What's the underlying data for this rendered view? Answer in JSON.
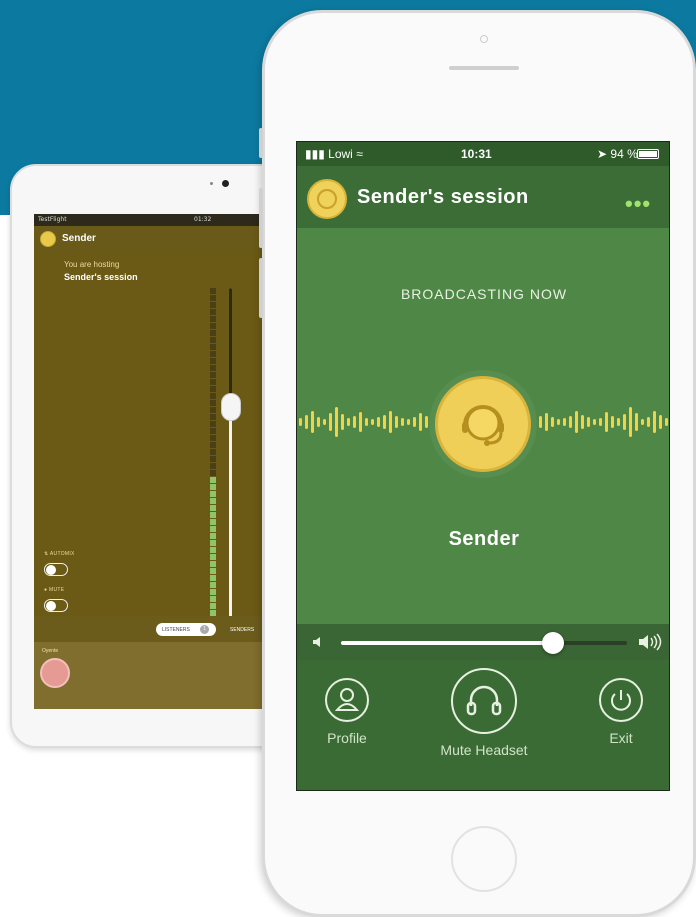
{
  "colors": {
    "banner": "#0c7aa0",
    "phone_screen_bg": "#4d8443",
    "ipad_screen_bg": "#6b5a16",
    "accent_gold": "#efcf58",
    "meter_green": "#8fc46a"
  },
  "ipad": {
    "status_left": "TestFlight",
    "status_time": "01:32",
    "header_title": "Sender",
    "hosting_label": "You are hosting",
    "session_name": "Sender's session",
    "automix_label": "AUTOMIX",
    "mute_label": "MUTE",
    "tabs": {
      "listeners_label": "LISTENERS",
      "listeners_count": "1",
      "senders_label": "SENDERS"
    },
    "listener_group_label": "Oyente",
    "meter_level": 0.42,
    "slider_level": 0.64
  },
  "phone": {
    "status": {
      "carrier": "Lowi",
      "time": "10:31",
      "battery": "94 %"
    },
    "header": {
      "title": "Sender's session",
      "more_icon": "ellipsis-icon"
    },
    "broadcast_label": "BROADCASTING NOW",
    "sender_name": "Sender",
    "volume_level": 0.74,
    "buttons": {
      "profile_label": "Profile",
      "mute_label": "Mute Headset",
      "exit_label": "Exit"
    }
  }
}
